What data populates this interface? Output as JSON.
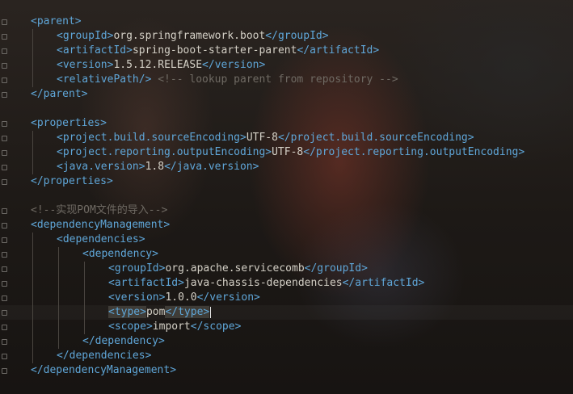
{
  "editor": {
    "lines": [
      {
        "indent": 0,
        "parts": [
          {
            "c": "bracket",
            "t": "<"
          },
          {
            "c": "tag",
            "t": "parent"
          },
          {
            "c": "bracket",
            "t": ">"
          }
        ]
      },
      {
        "indent": 1,
        "parts": [
          {
            "c": "bracket",
            "t": "<"
          },
          {
            "c": "tag",
            "t": "groupId"
          },
          {
            "c": "bracket",
            "t": ">"
          },
          {
            "c": "txt",
            "t": "org.springframework.boot"
          },
          {
            "c": "bracket",
            "t": "</"
          },
          {
            "c": "tag",
            "t": "groupId"
          },
          {
            "c": "bracket",
            "t": ">"
          }
        ]
      },
      {
        "indent": 1,
        "parts": [
          {
            "c": "bracket",
            "t": "<"
          },
          {
            "c": "tag",
            "t": "artifactId"
          },
          {
            "c": "bracket",
            "t": ">"
          },
          {
            "c": "txt",
            "t": "spring-boot-starter-parent"
          },
          {
            "c": "bracket",
            "t": "</"
          },
          {
            "c": "tag",
            "t": "artifactId"
          },
          {
            "c": "bracket",
            "t": ">"
          }
        ]
      },
      {
        "indent": 1,
        "parts": [
          {
            "c": "bracket",
            "t": "<"
          },
          {
            "c": "tag",
            "t": "version"
          },
          {
            "c": "bracket",
            "t": ">"
          },
          {
            "c": "txt",
            "t": "1.5.12.RELEASE"
          },
          {
            "c": "bracket",
            "t": "</"
          },
          {
            "c": "tag",
            "t": "version"
          },
          {
            "c": "bracket",
            "t": ">"
          }
        ]
      },
      {
        "indent": 1,
        "parts": [
          {
            "c": "bracket",
            "t": "<"
          },
          {
            "c": "tag",
            "t": "relativePath"
          },
          {
            "c": "bracket",
            "t": "/>"
          },
          {
            "c": "txt",
            "t": " "
          },
          {
            "c": "comment",
            "t": "<!-- lookup parent from repository -->"
          }
        ]
      },
      {
        "indent": 0,
        "parts": [
          {
            "c": "bracket",
            "t": "</"
          },
          {
            "c": "tag",
            "t": "parent"
          },
          {
            "c": "bracket",
            "t": ">"
          }
        ]
      },
      {
        "indent": 0,
        "parts": []
      },
      {
        "indent": 0,
        "parts": [
          {
            "c": "bracket",
            "t": "<"
          },
          {
            "c": "tag",
            "t": "properties"
          },
          {
            "c": "bracket",
            "t": ">"
          }
        ]
      },
      {
        "indent": 1,
        "parts": [
          {
            "c": "bracket",
            "t": "<"
          },
          {
            "c": "tag",
            "t": "project.build.sourceEncoding"
          },
          {
            "c": "bracket",
            "t": ">"
          },
          {
            "c": "txt",
            "t": "UTF-8"
          },
          {
            "c": "bracket",
            "t": "</"
          },
          {
            "c": "tag",
            "t": "project.build.sourceEncoding"
          },
          {
            "c": "bracket",
            "t": ">"
          }
        ]
      },
      {
        "indent": 1,
        "parts": [
          {
            "c": "bracket",
            "t": "<"
          },
          {
            "c": "tag",
            "t": "project.reporting.outputEncoding"
          },
          {
            "c": "bracket",
            "t": ">"
          },
          {
            "c": "txt",
            "t": "UTF-8"
          },
          {
            "c": "bracket",
            "t": "</"
          },
          {
            "c": "tag",
            "t": "project.reporting.outputEncoding"
          },
          {
            "c": "bracket",
            "t": ">"
          }
        ]
      },
      {
        "indent": 1,
        "parts": [
          {
            "c": "bracket",
            "t": "<"
          },
          {
            "c": "tag",
            "t": "java.version"
          },
          {
            "c": "bracket",
            "t": ">"
          },
          {
            "c": "txt",
            "t": "1.8"
          },
          {
            "c": "bracket",
            "t": "</"
          },
          {
            "c": "tag",
            "t": "java.version"
          },
          {
            "c": "bracket",
            "t": ">"
          }
        ]
      },
      {
        "indent": 0,
        "parts": [
          {
            "c": "bracket",
            "t": "</"
          },
          {
            "c": "tag",
            "t": "properties"
          },
          {
            "c": "bracket",
            "t": ">"
          }
        ]
      },
      {
        "indent": 0,
        "parts": []
      },
      {
        "indent": 0,
        "parts": [
          {
            "c": "comment",
            "t": "<!--实现POM文件的导入-->"
          }
        ]
      },
      {
        "indent": 0,
        "parts": [
          {
            "c": "bracket",
            "t": "<"
          },
          {
            "c": "tag",
            "t": "dependencyManagement"
          },
          {
            "c": "bracket",
            "t": ">"
          }
        ]
      },
      {
        "indent": 1,
        "parts": [
          {
            "c": "bracket",
            "t": "<"
          },
          {
            "c": "tag",
            "t": "dependencies"
          },
          {
            "c": "bracket",
            "t": ">"
          }
        ]
      },
      {
        "indent": 2,
        "parts": [
          {
            "c": "bracket",
            "t": "<"
          },
          {
            "c": "tag",
            "t": "dependency"
          },
          {
            "c": "bracket",
            "t": ">"
          }
        ]
      },
      {
        "indent": 3,
        "parts": [
          {
            "c": "bracket",
            "t": "<"
          },
          {
            "c": "tag",
            "t": "groupId"
          },
          {
            "c": "bracket",
            "t": ">"
          },
          {
            "c": "txt",
            "t": "org.apache.servicecomb"
          },
          {
            "c": "bracket",
            "t": "</"
          },
          {
            "c": "tag",
            "t": "groupId"
          },
          {
            "c": "bracket",
            "t": ">"
          }
        ]
      },
      {
        "indent": 3,
        "parts": [
          {
            "c": "bracket",
            "t": "<"
          },
          {
            "c": "tag",
            "t": "artifactId"
          },
          {
            "c": "bracket",
            "t": ">"
          },
          {
            "c": "txt",
            "t": "java-chassis-dependencies"
          },
          {
            "c": "bracket",
            "t": "</"
          },
          {
            "c": "tag",
            "t": "artifactId"
          },
          {
            "c": "bracket",
            "t": ">"
          }
        ]
      },
      {
        "indent": 3,
        "parts": [
          {
            "c": "bracket",
            "t": "<"
          },
          {
            "c": "tag",
            "t": "version"
          },
          {
            "c": "bracket",
            "t": ">"
          },
          {
            "c": "txt",
            "t": "1.0.0"
          },
          {
            "c": "bracket",
            "t": "</"
          },
          {
            "c": "tag",
            "t": "version"
          },
          {
            "c": "bracket",
            "t": ">"
          }
        ]
      },
      {
        "indent": 3,
        "cursor": true,
        "parts": [
          {
            "c": "bracket cur",
            "t": "<"
          },
          {
            "c": "tag cur",
            "t": "type"
          },
          {
            "c": "bracket cur",
            "t": ">"
          },
          {
            "c": "txt",
            "t": "pom"
          },
          {
            "c": "bracket cur",
            "t": "</"
          },
          {
            "c": "tag cur",
            "t": "type"
          },
          {
            "c": "bracket cur",
            "t": ">"
          }
        ]
      },
      {
        "indent": 3,
        "parts": [
          {
            "c": "bracket",
            "t": "<"
          },
          {
            "c": "tag",
            "t": "scope"
          },
          {
            "c": "bracket",
            "t": ">"
          },
          {
            "c": "txt",
            "t": "import"
          },
          {
            "c": "bracket",
            "t": "</"
          },
          {
            "c": "tag",
            "t": "scope"
          },
          {
            "c": "bracket",
            "t": ">"
          }
        ]
      },
      {
        "indent": 2,
        "parts": [
          {
            "c": "bracket",
            "t": "</"
          },
          {
            "c": "tag",
            "t": "dependency"
          },
          {
            "c": "bracket",
            "t": ">"
          }
        ]
      },
      {
        "indent": 1,
        "parts": [
          {
            "c": "bracket",
            "t": "</"
          },
          {
            "c": "tag",
            "t": "dependencies"
          },
          {
            "c": "bracket",
            "t": ">"
          }
        ]
      },
      {
        "indent": 0,
        "parts": [
          {
            "c": "bracket",
            "t": "</"
          },
          {
            "c": "tag",
            "t": "dependencyManagement"
          },
          {
            "c": "bracket",
            "t": ">"
          }
        ]
      }
    ]
  },
  "colors": {
    "tag": "#5fa6d8",
    "text": "#d4d0c6",
    "comment": "#6f6a63",
    "guide": "#4a4540"
  },
  "icons": {
    "fold": "fold-marker-icon"
  }
}
